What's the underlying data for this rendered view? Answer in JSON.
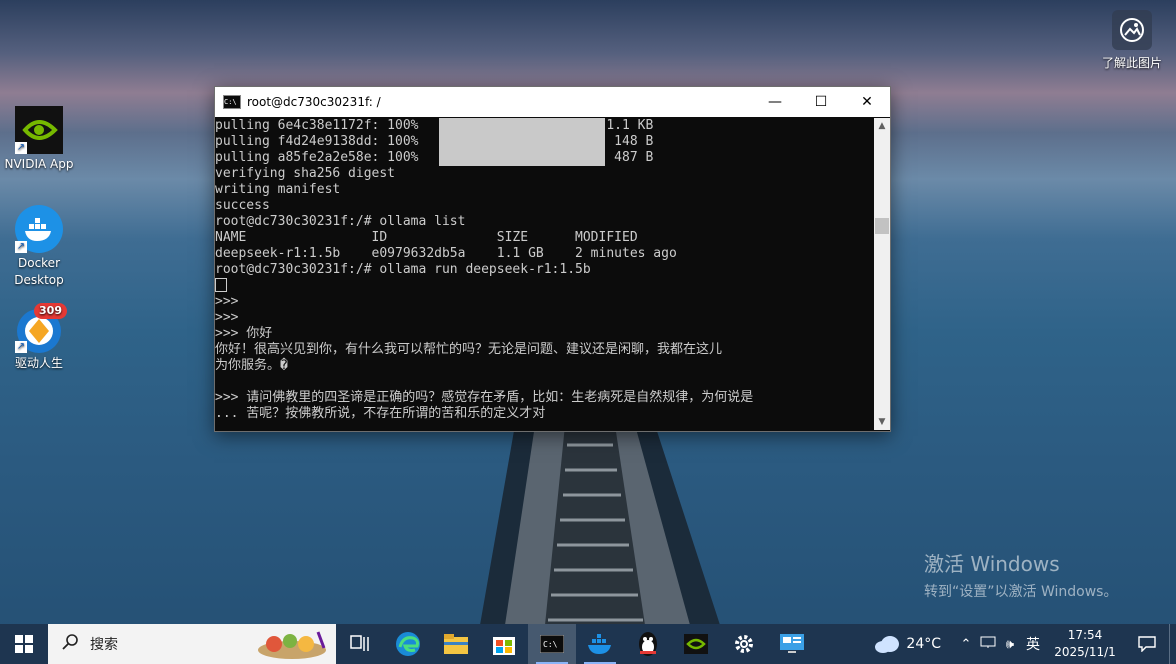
{
  "desktop": {
    "icons": [
      {
        "label": "NVIDIA App",
        "icon": "nvidia-icon"
      },
      {
        "label": "Docker Desktop",
        "icon": "docker-icon"
      },
      {
        "label": "驱动人生",
        "icon": "driver-life-icon",
        "badge": "309"
      }
    ],
    "about_image": "了解此图片",
    "watermark": {
      "line1": "激活 Windows",
      "line2": "转到“设置”以激活 Windows。"
    }
  },
  "terminal": {
    "title": "root@dc730c30231f: /",
    "lines": [
      {
        "text": "pulling 6e4c38e1172f: 100%                        1.1 KB",
        "bar": true
      },
      {
        "text": "pulling f4d24e9138dd: 100%                         148 B",
        "bar": true
      },
      {
        "text": "pulling a85fe2a2e58e: 100%                         487 B",
        "bar": true
      },
      {
        "text": "verifying sha256 digest"
      },
      {
        "text": "writing manifest"
      },
      {
        "text": "success"
      },
      {
        "text": "root@dc730c30231f:/# ollama list"
      },
      {
        "text": "NAME                ID              SIZE      MODIFIED"
      },
      {
        "text": "deepseek-r1:1.5b    e0979632db5a    1.1 GB    2 minutes ago"
      },
      {
        "text": "root@dc730c30231f:/# ollama run deepseek-r1:1.5b"
      },
      {
        "text": "",
        "cursor": true
      },
      {
        "text": ">>>"
      },
      {
        "text": ">>>"
      },
      {
        "text": ">>> 你好"
      },
      {
        "text": "你好！很高兴见到你，有什么我可以帮忙的吗？无论是问题、建议还是闲聊，我都在这儿"
      },
      {
        "text": "为你服务。�"
      },
      {
        "text": ""
      },
      {
        "text": ">>> 请问佛教里的四圣谛是正确的吗？感觉存在矛盾，比如：生老病死是自然规律，为何说是"
      },
      {
        "text": "... 苦呢？按佛教所说，不存在所谓的苦和乐的定义才对"
      }
    ]
  },
  "taskbar": {
    "search_placeholder": "搜索",
    "apps": [
      "task-view-icon",
      "edge-icon",
      "file-explorer-icon",
      "store-icon",
      "terminal-icon",
      "docker-icon",
      "qq-icon",
      "nvidia-icon",
      "settings-icon",
      "remote-desktop-icon"
    ],
    "active_app": "terminal-icon",
    "weather": "24°C",
    "ime": "英",
    "time": "17:54",
    "date": "2025/11/1"
  },
  "colors": {
    "terminal_bg": "#0c0c0c",
    "terminal_fg": "#cccccc",
    "taskbar_bg": "#1e3550"
  }
}
